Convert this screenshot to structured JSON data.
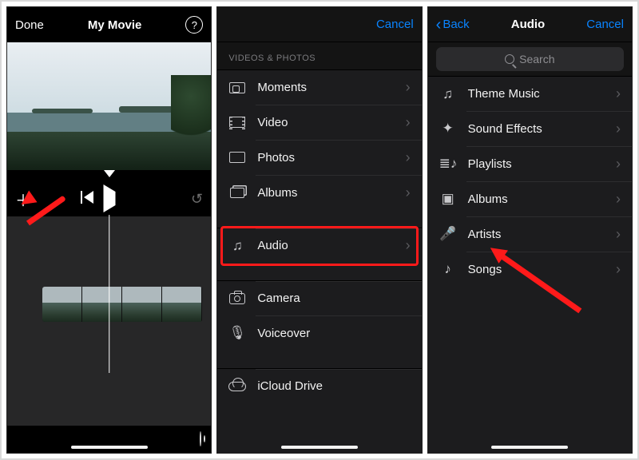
{
  "panelA": {
    "done": "Done",
    "title": "My Movie",
    "help": "?"
  },
  "panelB": {
    "cancel": "Cancel",
    "section": "VIDEOS & PHOTOS",
    "items": {
      "moments": "Moments",
      "video": "Video",
      "photos": "Photos",
      "albums": "Albums",
      "audio": "Audio",
      "camera": "Camera",
      "voiceover": "Voiceover",
      "icloud": "iCloud Drive"
    }
  },
  "panelC": {
    "back": "Back",
    "title": "Audio",
    "cancel": "Cancel",
    "searchPlaceholder": "Search",
    "items": {
      "theme": "Theme Music",
      "sfx": "Sound Effects",
      "playlists": "Playlists",
      "albums": "Albums",
      "artists": "Artists",
      "songs": "Songs"
    }
  }
}
